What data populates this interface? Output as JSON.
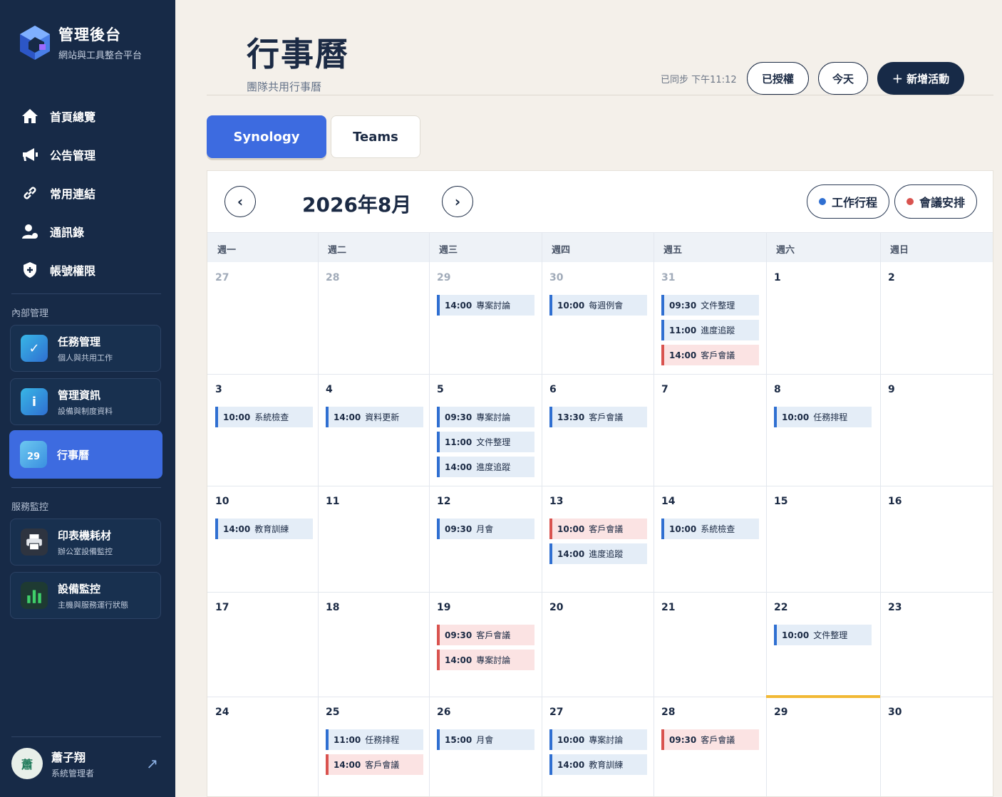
{
  "brand": {
    "title": "管理後台",
    "subtitle": "網站與工具整合平台"
  },
  "nav": [
    {
      "label": "首頁總覽",
      "icon": "home-icon"
    },
    {
      "label": "公告管理",
      "icon": "megaphone-icon"
    },
    {
      "label": "常用連結",
      "icon": "link-icon"
    },
    {
      "label": "通訊錄",
      "icon": "contacts-icon"
    },
    {
      "label": "帳號權限",
      "icon": "shield-icon"
    }
  ],
  "sections": {
    "internal": "內部管理",
    "monitor": "服務監控"
  },
  "cards": [
    {
      "title": "任務管理",
      "sub": "個人與共用工作",
      "icon": "check-icon",
      "color": "#2f8fd9"
    },
    {
      "title": "管理資訊",
      "sub": "設備與制度資料",
      "icon": "info-icon",
      "color": "#2f8fd9"
    },
    {
      "title": "行事曆",
      "sub": "",
      "icon": "calendar-icon",
      "icon_text": "29",
      "color": "#4aa5e8"
    },
    {
      "title": "印表機耗材",
      "sub": "辦公室設備監控",
      "icon": "printer-icon",
      "color": "#2e3440"
    },
    {
      "title": "設備監控",
      "sub": "主機與服務運行狀態",
      "icon": "bar-chart-icon",
      "color": "#1e3a32"
    }
  ],
  "user": {
    "avatar": "蕭",
    "name": "蕭子翔",
    "role": "系統管理者"
  },
  "header": {
    "title": "行事曆",
    "subtitle": "團隊共用行事曆",
    "sync": "已同步 下午11:12",
    "authorized": "已授權",
    "today": "今天",
    "add": "＋ 新增活動"
  },
  "tabs": [
    "Synology",
    "Teams"
  ],
  "calendar": {
    "month": "2026年8月",
    "legend": [
      {
        "label": "工作行程",
        "color": "#2f6fd1"
      },
      {
        "label": "會議安排",
        "color": "#d9534f"
      }
    ],
    "weekdays": [
      "週一",
      "週二",
      "週三",
      "週四",
      "週五",
      "週六",
      "週日"
    ],
    "weeks": [
      [
        {
          "day": "27",
          "muted": true,
          "events": []
        },
        {
          "day": "28",
          "muted": true,
          "events": []
        },
        {
          "day": "29",
          "muted": true,
          "events": [
            {
              "time": "14:00",
              "title": "專案討論",
              "kind": "work"
            }
          ]
        },
        {
          "day": "30",
          "muted": true,
          "events": [
            {
              "time": "10:00",
              "title": "每週例會",
              "kind": "work"
            }
          ]
        },
        {
          "day": "31",
          "muted": true,
          "events": [
            {
              "time": "09:30",
              "title": "文件整理",
              "kind": "work"
            },
            {
              "time": "11:00",
              "title": "進度追蹤",
              "kind": "work"
            },
            {
              "time": "14:00",
              "title": "客戶會議",
              "kind": "meet"
            }
          ]
        },
        {
          "day": "1",
          "events": []
        },
        {
          "day": "2",
          "events": []
        }
      ],
      [
        {
          "day": "3",
          "events": [
            {
              "time": "10:00",
              "title": "系統檢查",
              "kind": "work"
            }
          ]
        },
        {
          "day": "4",
          "events": [
            {
              "time": "14:00",
              "title": "資料更新",
              "kind": "work"
            }
          ]
        },
        {
          "day": "5",
          "events": [
            {
              "time": "09:30",
              "title": "專案討論",
              "kind": "work"
            },
            {
              "time": "11:00",
              "title": "文件整理",
              "kind": "work"
            },
            {
              "time": "14:00",
              "title": "進度追蹤",
              "kind": "work"
            }
          ]
        },
        {
          "day": "6",
          "events": [
            {
              "time": "13:30",
              "title": "客戶會議",
              "kind": "work"
            }
          ]
        },
        {
          "day": "7",
          "events": []
        },
        {
          "day": "8",
          "events": [
            {
              "time": "10:00",
              "title": "任務排程",
              "kind": "work"
            }
          ]
        },
        {
          "day": "9",
          "events": []
        }
      ],
      [
        {
          "day": "10",
          "events": [
            {
              "time": "14:00",
              "title": "教育訓練",
              "kind": "work"
            }
          ]
        },
        {
          "day": "11",
          "events": []
        },
        {
          "day": "12",
          "events": [
            {
              "time": "09:30",
              "title": "月會",
              "kind": "work"
            }
          ]
        },
        {
          "day": "13",
          "events": [
            {
              "time": "10:00",
              "title": "客戶會議",
              "kind": "meet"
            },
            {
              "time": "14:00",
              "title": "進度追蹤",
              "kind": "work"
            }
          ]
        },
        {
          "day": "14",
          "events": [
            {
              "time": "10:00",
              "title": "系統檢查",
              "kind": "work"
            }
          ]
        },
        {
          "day": "15",
          "events": []
        },
        {
          "day": "16",
          "events": []
        }
      ],
      [
        {
          "day": "17",
          "events": []
        },
        {
          "day": "18",
          "events": []
        },
        {
          "day": "19",
          "events": [
            {
              "time": "09:30",
              "title": "客戶會議",
              "kind": "meet"
            },
            {
              "time": "14:00",
              "title": "專案討論",
              "kind": "meet"
            }
          ]
        },
        {
          "day": "20",
          "events": []
        },
        {
          "day": "21",
          "events": []
        },
        {
          "day": "22",
          "events": [
            {
              "time": "10:00",
              "title": "文件整理",
              "kind": "work"
            }
          ]
        },
        {
          "day": "23",
          "events": []
        }
      ],
      [
        {
          "day": "24",
          "events": []
        },
        {
          "day": "25",
          "events": [
            {
              "time": "11:00",
              "title": "任務排程",
              "kind": "work"
            },
            {
              "time": "14:00",
              "title": "客戶會議",
              "kind": "meet"
            }
          ]
        },
        {
          "day": "26",
          "events": [
            {
              "time": "15:00",
              "title": "月會",
              "kind": "work"
            }
          ]
        },
        {
          "day": "27",
          "events": [
            {
              "time": "10:00",
              "title": "專案討論",
              "kind": "work"
            },
            {
              "time": "14:00",
              "title": "教育訓練",
              "kind": "work"
            }
          ]
        },
        {
          "day": "28",
          "events": [
            {
              "time": "09:30",
              "title": "客戶會議",
              "kind": "meet"
            }
          ]
        },
        {
          "day": "29",
          "today": true,
          "events": []
        },
        {
          "day": "30",
          "events": []
        }
      ]
    ]
  }
}
